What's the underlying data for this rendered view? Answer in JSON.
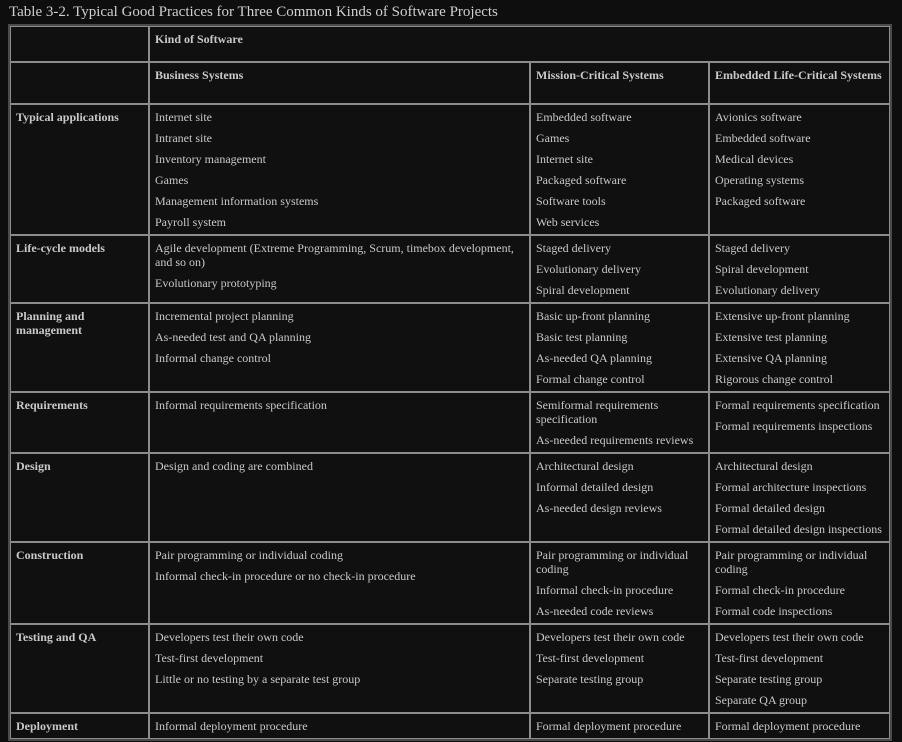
{
  "caption": "Table 3-2. Typical Good Practices for Three Common Kinds of Software Projects",
  "header": {
    "group_label": "Kind of Software",
    "columns": [
      "Business Systems",
      "Mission-Critical Systems",
      "Embedded Life-Critical Systems"
    ]
  },
  "rows": [
    {
      "label": "Typical applications",
      "business": [
        "Internet site",
        "Intranet site",
        "Inventory management",
        "Games",
        "Management information systems",
        "Payroll system"
      ],
      "mission": [
        "Embedded software",
        "Games",
        "Internet site",
        "Packaged software",
        "Software tools",
        "Web services"
      ],
      "embedded": [
        "Avionics software",
        "Embedded software",
        "Medical devices",
        "Operating systems",
        "Packaged software"
      ]
    },
    {
      "label": "Life-cycle models",
      "business": [
        "Agile development (Extreme Programming, Scrum, timebox development, and so on)",
        "Evolutionary prototyping"
      ],
      "mission": [
        "Staged delivery",
        "Evolutionary delivery",
        "Spiral development"
      ],
      "embedded": [
        "Staged delivery",
        "Spiral development",
        "Evolutionary delivery"
      ]
    },
    {
      "label": "Planning and management",
      "business": [
        "Incremental project planning",
        "As-needed test and QA planning",
        "Informal change control"
      ],
      "mission": [
        "Basic up-front planning",
        "Basic test planning",
        "As-needed QA planning",
        "Formal change control"
      ],
      "embedded": [
        "Extensive up-front planning",
        "Extensive test planning",
        "Extensive QA planning",
        "Rigorous change control"
      ]
    },
    {
      "label": "Requirements",
      "business": [
        "Informal requirements specification"
      ],
      "mission": [
        "Semiformal requirements specification",
        "As-needed requirements reviews"
      ],
      "embedded": [
        "Formal requirements specification",
        "Formal requirements inspections"
      ]
    },
    {
      "label": "Design",
      "business": [
        "Design and coding are combined"
      ],
      "mission": [
        "Architectural design",
        "Informal detailed design",
        "As-needed design reviews"
      ],
      "embedded": [
        "Architectural design",
        "Formal architecture inspections",
        "Formal detailed design",
        "Formal detailed design inspections"
      ]
    },
    {
      "label": "Construction",
      "business": [
        "Pair programming or individual coding",
        "Informal check-in procedure or no check-in procedure"
      ],
      "mission": [
        "Pair programming or individual coding",
        "Informal check-in procedure",
        "As-needed code reviews"
      ],
      "embedded": [
        "Pair programming or individual coding",
        "Formal check-in procedure",
        "Formal code inspections"
      ]
    },
    {
      "label": "Testing and QA",
      "business": [
        "Developers test their own code",
        "Test-first development",
        "Little or no testing by a separate test group"
      ],
      "mission": [
        "Developers test their own code",
        "Test-first development",
        "Separate testing group"
      ],
      "embedded": [
        "Developers test their own code",
        "Test-first development",
        "Separate testing group",
        "Separate QA group"
      ]
    },
    {
      "label": "Deployment",
      "business": [
        "Informal deployment procedure"
      ],
      "mission": [
        "Formal deployment procedure"
      ],
      "embedded": [
        "Formal deployment procedure"
      ]
    }
  ]
}
